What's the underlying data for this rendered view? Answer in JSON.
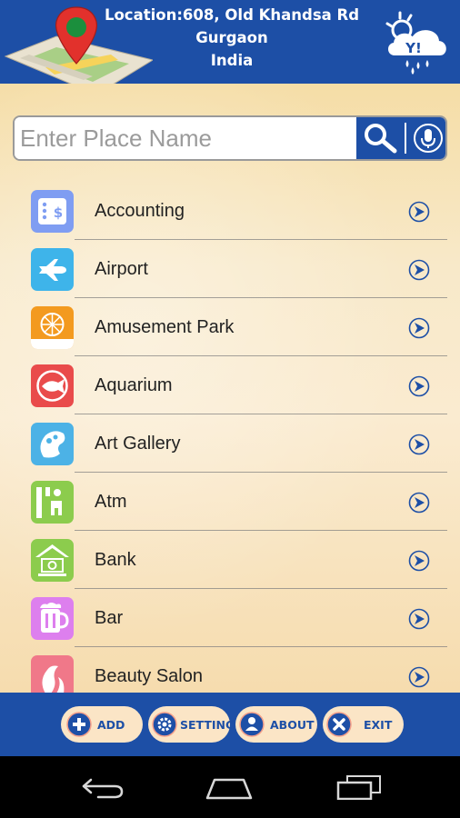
{
  "header": {
    "location_line1": "Location:608, Old Khandsa Rd",
    "location_line2": "Gurgaon",
    "location_line3": "India",
    "logo_icon": "map-pin-icon",
    "weather_icon": "yahoo-weather-icon",
    "weather_badge": "Y!"
  },
  "search": {
    "placeholder": "Enter Place Name",
    "value": "",
    "search_icon": "magnifier-icon",
    "mic_icon": "microphone-icon"
  },
  "categories": [
    {
      "label": "Accounting",
      "icon": "accounting-icon",
      "color": "#7f9df2"
    },
    {
      "label": "Airport",
      "icon": "airplane-icon",
      "color": "#3eb4ea"
    },
    {
      "label": "Amusement Park",
      "icon": "ferris-wheel-icon",
      "color": "#f39a1f"
    },
    {
      "label": "Aquarium",
      "icon": "fish-icon",
      "color": "#e94b4b"
    },
    {
      "label": "Art Gallery",
      "icon": "art-icon",
      "color": "#4cb2e6"
    },
    {
      "label": "Atm",
      "icon": "atm-icon",
      "color": "#8ccc4d"
    },
    {
      "label": "Bank",
      "icon": "bank-icon",
      "color": "#8ccc4d"
    },
    {
      "label": "Bar",
      "icon": "beer-mug-icon",
      "color": "#dd7fee"
    },
    {
      "label": "Beauty Salon",
      "icon": "salon-icon",
      "color": "#f07889"
    }
  ],
  "toolbar": {
    "add_label": "ADD",
    "setting_label": "SETTING",
    "about_label": "ABOUT",
    "exit_label": "EXIT"
  },
  "colors": {
    "primary_blue": "#1d4fa6",
    "button_bg": "#fbe5c6",
    "content_bg": "#f8e4b8"
  }
}
